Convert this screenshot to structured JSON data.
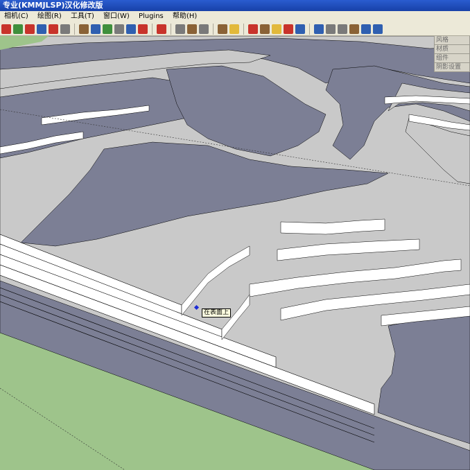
{
  "window": {
    "title": "专业(KMMJLSP)汉化修改版"
  },
  "menu": {
    "items": [
      "相机(C)",
      "绘图(R)",
      "工具(T)",
      "窗口(W)",
      "Plugins",
      "帮助(H)"
    ]
  },
  "trays": {
    "items": [
      "风格",
      "材质",
      "组件",
      "阴影设置"
    ]
  },
  "viewport": {
    "tooltip": "在表面上"
  },
  "toolbar": {
    "icons": [
      "arc-icon",
      "freehand-icon",
      "pushpull-icon",
      "followme-icon",
      "offset-icon",
      "erase-icon",
      "paint-icon",
      "measure-icon",
      "protractor-icon",
      "axes-icon",
      "dimension-icon",
      "text-icon",
      "3dtext-icon",
      "section-icon",
      "orbit-icon",
      "pan-icon",
      "zoom-icon",
      "zoom-window-icon",
      "zoom-extents-icon",
      "previous-icon",
      "next-icon",
      "xray-icon",
      "wireframe-icon",
      "hidden-line-icon",
      "shaded-icon",
      "shaded-texture-icon",
      "monochrome-icon",
      "iso-view-icon",
      "top-view-icon",
      "front-view-icon",
      "right-view-icon",
      "back-view-icon",
      "left-view-icon"
    ],
    "colors": {
      "blue": "#2f5fb0",
      "red": "#c8332b",
      "green": "#3f8f3c",
      "brown": "#8a6236",
      "yellow": "#e2b93b",
      "gray": "#7a7a7a"
    }
  },
  "scene": {
    "colors": {
      "terrain": "#c9c9c9",
      "shadow": "#7c7f95",
      "wall": "#ffffff",
      "ground": "#9ec48b",
      "edge": "#000000"
    }
  }
}
